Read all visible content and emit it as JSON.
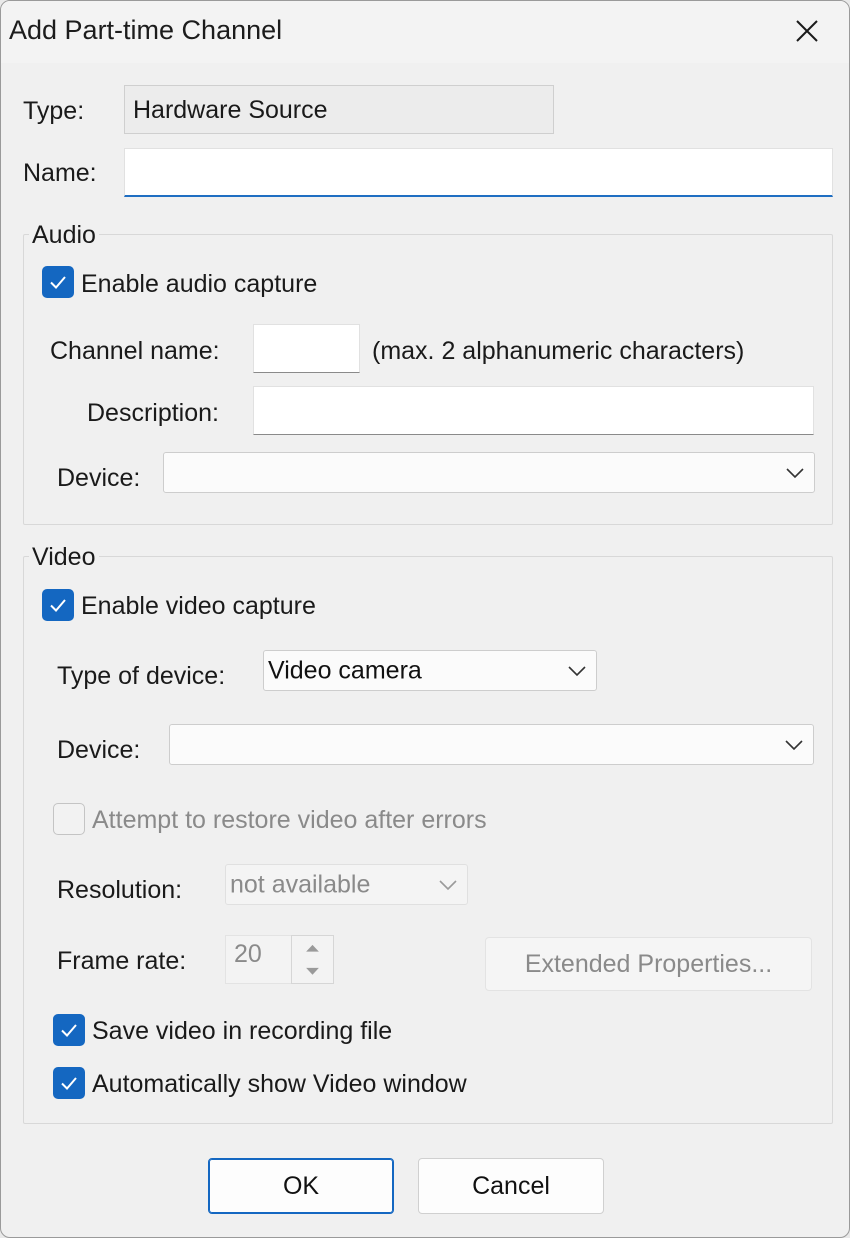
{
  "window": {
    "title": "Add Part-time Channel"
  },
  "general": {
    "type_label": "Type:",
    "type_value": "Hardware Source",
    "name_label": "Name:",
    "name_value": ""
  },
  "audio": {
    "group_title": "Audio",
    "enable_label": "Enable audio capture",
    "enable_checked": true,
    "channel_name_label": "Channel name:",
    "channel_name_value": "",
    "channel_name_hint": "(max. 2 alphanumeric characters)",
    "description_label": "Description:",
    "description_value": "",
    "device_label": "Device:",
    "device_value": ""
  },
  "video": {
    "group_title": "Video",
    "enable_label": "Enable video capture",
    "enable_checked": true,
    "type_of_device_label": "Type of device:",
    "type_of_device_value": "Video camera",
    "device_label": "Device:",
    "device_value": "",
    "restore_label": "Attempt to restore video after errors",
    "restore_checked": false,
    "resolution_label": "Resolution:",
    "resolution_value": "not available",
    "frame_rate_label": "Frame rate:",
    "frame_rate_value": "20",
    "extended_properties_label": "Extended Properties...",
    "save_video_label": "Save video in recording file",
    "save_video_checked": true,
    "auto_show_label": "Automatically show Video window",
    "auto_show_checked": true
  },
  "buttons": {
    "ok_label": "OK",
    "cancel_label": "Cancel"
  },
  "icons": {
    "close": "close-icon",
    "checkmark": "checkmark-icon",
    "dropdown": "chevron-down-icon",
    "spin_up": "arrow-up-icon",
    "spin_down": "arrow-down-icon"
  },
  "colors": {
    "accent": "#1467c1",
    "disabled_text": "#8a8a8a",
    "background": "#f0f0f0"
  }
}
